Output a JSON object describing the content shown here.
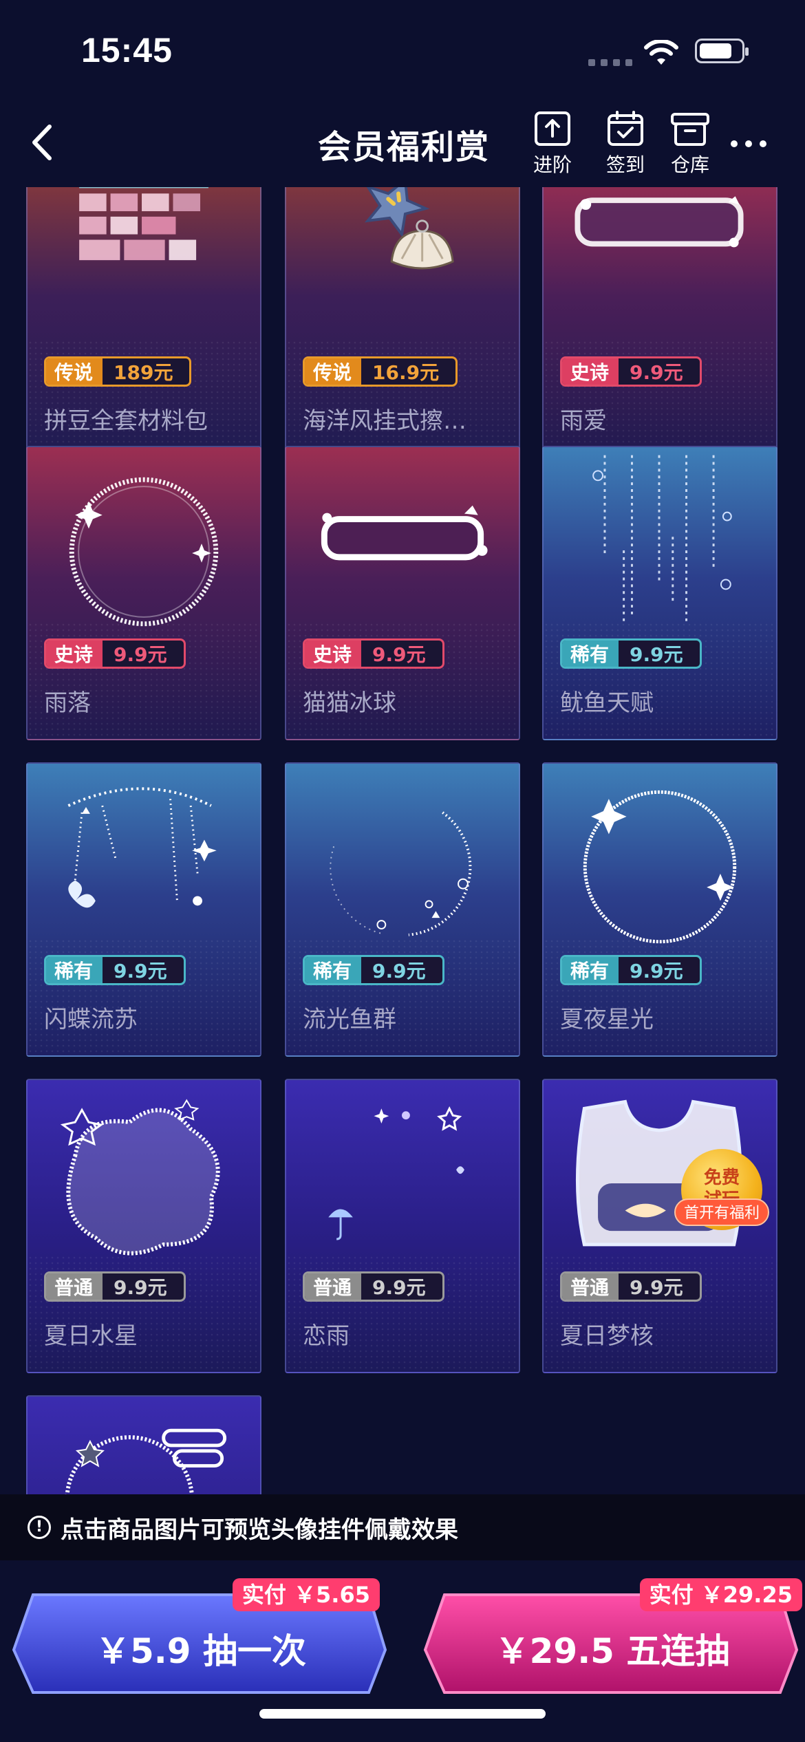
{
  "status_bar": {
    "time": "15:45"
  },
  "nav": {
    "title": "会员福利赏",
    "buttons": [
      {
        "label": "进阶",
        "icon": "upload-icon"
      },
      {
        "label": "签到",
        "icon": "calendar-check-icon"
      },
      {
        "label": "仓库",
        "icon": "box-icon"
      }
    ]
  },
  "items": [
    {
      "name": "拼豆全套材料包",
      "tier": "传说",
      "price": "189元",
      "rarity": "legend"
    },
    {
      "name": "海洋风挂式擦…",
      "tier": "传说",
      "price": "16.9元",
      "rarity": "legend"
    },
    {
      "name": "雨爱",
      "tier": "史诗",
      "price": "9.9元",
      "rarity": "epic"
    },
    {
      "name": "雨落",
      "tier": "史诗",
      "price": "9.9元",
      "rarity": "epic"
    },
    {
      "name": "猫猫冰球",
      "tier": "史诗",
      "price": "9.9元",
      "rarity": "epic"
    },
    {
      "name": "鱿鱼天赋",
      "tier": "稀有",
      "price": "9.9元",
      "rarity": "rare"
    },
    {
      "name": "闪蝶流苏",
      "tier": "稀有",
      "price": "9.9元",
      "rarity": "rare"
    },
    {
      "name": "流光鱼群",
      "tier": "稀有",
      "price": "9.9元",
      "rarity": "rare"
    },
    {
      "name": "夏夜星光",
      "tier": "稀有",
      "price": "9.9元",
      "rarity": "rare"
    },
    {
      "name": "夏日水星",
      "tier": "普通",
      "price": "9.9元",
      "rarity": "common"
    },
    {
      "name": "恋雨",
      "tier": "普通",
      "price": "9.9元",
      "rarity": "common"
    },
    {
      "name": "夏日梦核",
      "tier": "普通",
      "price": "9.9元",
      "rarity": "common"
    }
  ],
  "free_play": {
    "line1": "免费",
    "line2": "试玩",
    "ribbon": "首开有福利"
  },
  "tip": "点击商品图片可预览头像挂件佩戴效果",
  "draw_once": {
    "label": "￥5.9 抽一次",
    "actual": "实付 ￥5.65"
  },
  "draw_five": {
    "label": "￥29.5 五连抽",
    "actual": "实付 ￥29.25"
  }
}
